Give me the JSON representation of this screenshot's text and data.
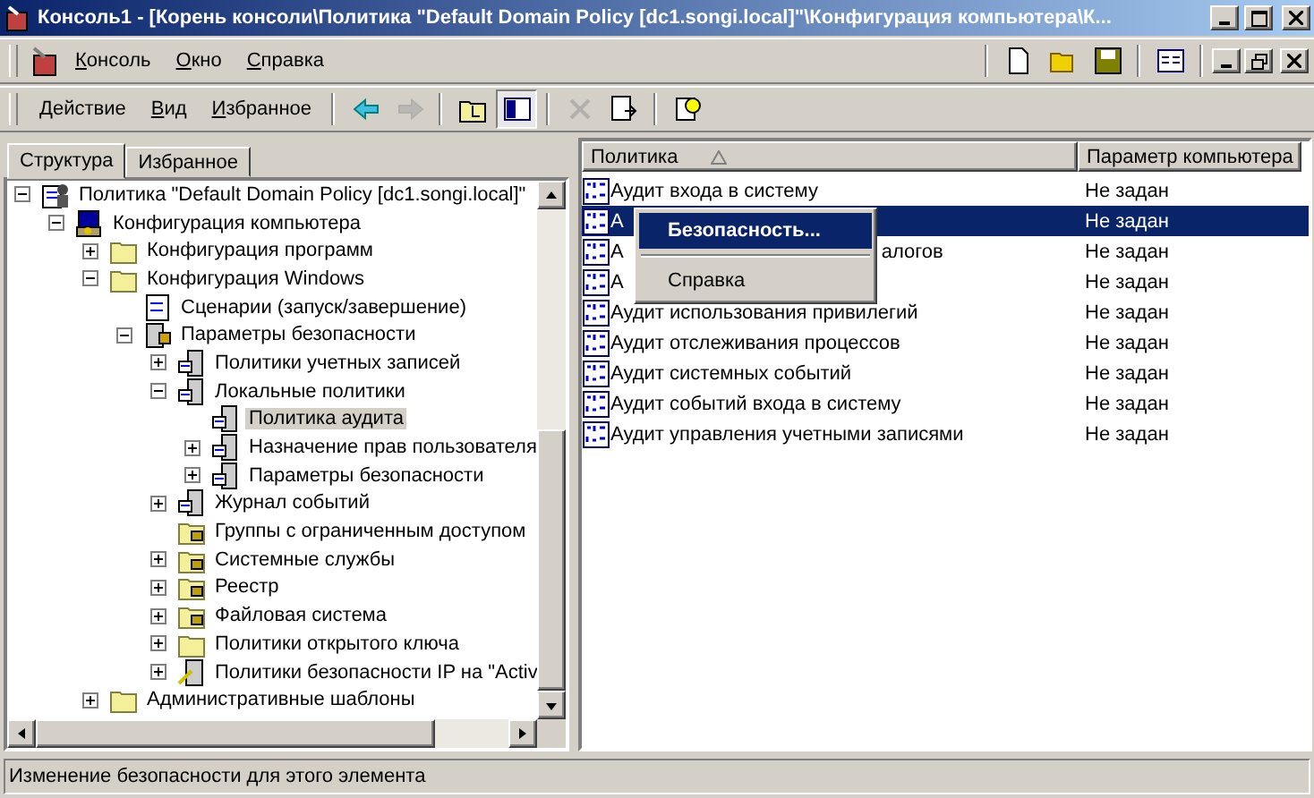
{
  "window": {
    "title": "Консоль1 - [Корень консоли\\Политика \"Default Domain Policy [dc1.songi.local]\"\\Конфигурация компьютера\\К..."
  },
  "menu_bar": [
    "Консоль",
    "Окно",
    "Справка"
  ],
  "action_bar": [
    "Действие",
    "Вид",
    "Избранное"
  ],
  "toolbar": [
    {
      "kind": "back",
      "disabled": false
    },
    {
      "kind": "forward",
      "disabled": true
    },
    {
      "kind": "up",
      "disabled": false
    },
    {
      "kind": "tree",
      "disabled": false
    },
    {
      "kind": "delete",
      "disabled": true
    },
    {
      "kind": "export",
      "disabled": false
    },
    {
      "kind": "help",
      "disabled": false
    }
  ],
  "tabs": [
    {
      "label": "Структура",
      "selected": true
    },
    {
      "label": "Избранное",
      "selected": false
    }
  ],
  "tree": [
    {
      "label": "Политика \"Default Domain Policy [dc1.songi.local]\"",
      "kind": "policy",
      "expanded": true,
      "selected": false,
      "children": [
        {
          "label": "Конфигурация компьютера",
          "kind": "computer",
          "expanded": true,
          "selected": false,
          "children": [
            {
              "label": "Конфигурация программ",
              "kind": "folder",
              "expanded": false,
              "selected": false
            },
            {
              "label": "Конфигурация Windows",
              "kind": "folder",
              "expanded": true,
              "selected": false,
              "children": [
                {
                  "label": "Сценарии (запуск/завершение)",
                  "kind": "script",
                  "selected": false
                },
                {
                  "label": "Параметры безопасности",
                  "kind": "security",
                  "expanded": true,
                  "selected": false,
                  "children": [
                    {
                      "label": "Политики учетных записей",
                      "kind": "server",
                      "expanded": false,
                      "selected": false
                    },
                    {
                      "label": "Локальные политики",
                      "kind": "server",
                      "expanded": true,
                      "selected": false,
                      "children": [
                        {
                          "label": "Политика аудита",
                          "kind": "server",
                          "selected": true
                        },
                        {
                          "label": "Назначение прав пользователя",
                          "kind": "server",
                          "expanded": false,
                          "selected": false
                        },
                        {
                          "label": "Параметры безопасности",
                          "kind": "server",
                          "expanded": false,
                          "selected": false
                        }
                      ]
                    },
                    {
                      "label": "Журнал событий",
                      "kind": "server",
                      "expanded": false,
                      "selected": false
                    },
                    {
                      "label": "Группы с ограниченным доступом",
                      "kind": "lockfolder",
                      "selected": false
                    },
                    {
                      "label": "Системные службы",
                      "kind": "lockfolder",
                      "expanded": false,
                      "selected": false
                    },
                    {
                      "label": "Реестр",
                      "kind": "lockfolder",
                      "expanded": false,
                      "selected": false
                    },
                    {
                      "label": "Файловая система",
                      "kind": "lockfolder",
                      "expanded": false,
                      "selected": false
                    },
                    {
                      "label": "Политики открытого ключа",
                      "kind": "folder",
                      "expanded": false,
                      "selected": false
                    },
                    {
                      "label": "Политики безопасности IP на \"Activ",
                      "kind": "ipsec",
                      "expanded": false,
                      "selected": false
                    }
                  ]
                }
              ]
            },
            {
              "label": "Административные шаблоны",
              "kind": "folder",
              "expanded": false,
              "selected": false
            }
          ]
        }
      ]
    }
  ],
  "table": {
    "columns": [
      "Политика",
      "Параметр компьютера"
    ],
    "rows": [
      {
        "name": "Аудит входа в систему",
        "value": "Не задан",
        "selected": false
      },
      {
        "name": "А",
        "value": "Не задан",
        "selected": true
      },
      {
        "name": "А",
        "name_tail": "алогов",
        "value": "Не задан",
        "selected": false
      },
      {
        "name": "А",
        "value": "Не задан",
        "selected": false
      },
      {
        "name": "Аудит использования привилегий",
        "value": "Не задан",
        "selected": false
      },
      {
        "name": "Аудит отслеживания процессов",
        "value": "Не задан",
        "selected": false
      },
      {
        "name": "Аудит системных событий",
        "value": "Не задан",
        "selected": false
      },
      {
        "name": "Аудит событий входа в систему",
        "value": "Не задан",
        "selected": false
      },
      {
        "name": "Аудит управления учетными записями",
        "value": "Не задан",
        "selected": false
      }
    ]
  },
  "context_menu": [
    {
      "label": "Безопасность...",
      "selected": true,
      "bold": true
    },
    {
      "label": "Справка",
      "selected": false,
      "bold": false
    }
  ],
  "status_bar": "Изменение безопасности для этого элемента"
}
